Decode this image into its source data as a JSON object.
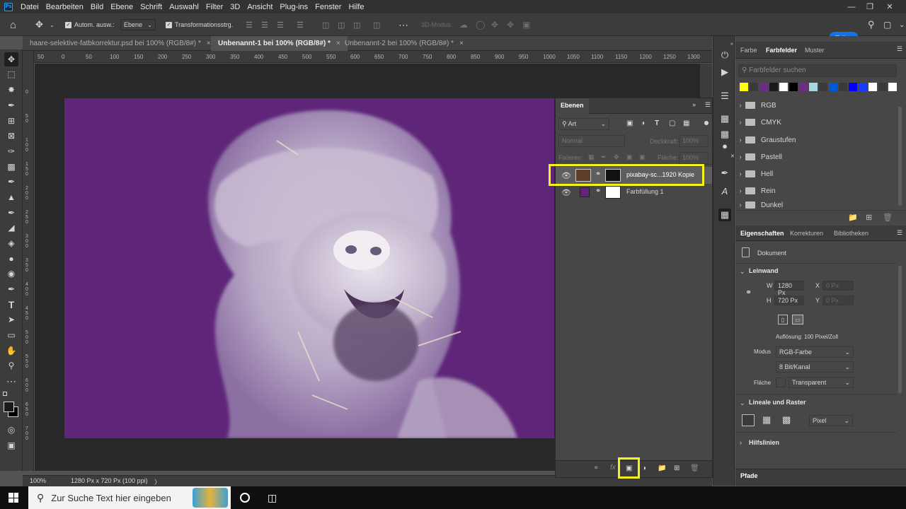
{
  "menubar": {
    "logo": "Ps",
    "items": [
      "Datei",
      "Bearbeiten",
      "Bild",
      "Ebene",
      "Schrift",
      "Auswahl",
      "Filter",
      "3D",
      "Ansicht",
      "Plug-ins",
      "Fenster",
      "Hilfe"
    ]
  },
  "options": {
    "auto_select_label": "Autom. ausw.:",
    "auto_select_value": "Ebene",
    "transform_label": "Transformationsstrg.",
    "mode3d_label": "3D-Modus:",
    "share_label": "Teilen"
  },
  "tabs": [
    {
      "label": "haare-selektive-fatbkorrektur.psd bei 100% (RGB/8#) *",
      "close": "×"
    },
    {
      "label": "Unbenannt-1 bei 100% (RGB/8#) *",
      "close": "×"
    },
    {
      "label": "Unbenannt-2 bei 100% (RGB/8#) *",
      "close": "×"
    }
  ],
  "ruler": {
    "h_ticks": [
      "50",
      "0",
      "50",
      "100",
      "150",
      "200",
      "250",
      "300",
      "350",
      "400",
      "450",
      "500",
      "550",
      "600",
      "650",
      "700",
      "750",
      "800",
      "850",
      "900",
      "950",
      "1000",
      "1050",
      "1100",
      "1150",
      "1200",
      "1250",
      "1300"
    ],
    "v_ticks": [
      "0",
      "5\n0",
      "1\n0\n0",
      "1\n5\n0",
      "2\n0\n0",
      "2\n5\n0",
      "3\n0\n0",
      "3\n5\n0",
      "4\n0\n0",
      "4\n5\n0",
      "5\n0\n0",
      "5\n5\n0",
      "6\n0\n0",
      "6\n5\n0",
      "7\n0\n0"
    ]
  },
  "status": {
    "zoom": "100%",
    "doc_info": "1280 Px x 720 Px (100 ppi)",
    "arrow": "〉"
  },
  "layers_panel": {
    "title": "Ebenen",
    "filter_kind": "Art",
    "blend_mode": "Normal",
    "opacity_label": "Deckkraft:",
    "opacity_value": "100%",
    "lock_label": "Fixieren:",
    "fill_label": "Fläche:",
    "fill_value": "100%",
    "layers": [
      {
        "name": "pixabay-sc...1920 Kopie",
        "selected": true
      },
      {
        "name": "Farbfüllung 1",
        "selected": false
      }
    ],
    "footer_icons": [
      "link-icon",
      "fx-icon",
      "mask-icon",
      "adjustment-icon",
      "folder-icon",
      "new-layer-icon",
      "trash-icon"
    ]
  },
  "swatches_panel": {
    "tabs": [
      "Farbe",
      "Farbfelder",
      "Muster"
    ],
    "active_tab": "Farbfelder",
    "search_placeholder": "Farbfelder suchen",
    "swatch_colors": [
      "#ffff00",
      "#3a3a3a",
      "#6b2d86",
      "#1a1a1a",
      "#ffffff",
      "#000000",
      "#6b2d86",
      "#a8d8e0",
      "#3a3a3a",
      "#0059d6",
      "#3a3a3a",
      "#0000ff",
      "#1a3aff",
      "#ffffff",
      "#3a3a3a",
      "#ffffff"
    ],
    "folders": [
      "RGB",
      "CMYK",
      "Graustufen",
      "Pastell",
      "Hell",
      "Rein",
      "Dunkel"
    ]
  },
  "properties_panel": {
    "tabs": [
      "Eigenschaften",
      "Korrekturen",
      "Bibliotheken"
    ],
    "active_tab": "Eigenschaften",
    "doc_label": "Dokument",
    "canvas_section": "Leinwand",
    "w_label": "W",
    "w_value": "1280 Px",
    "x_label": "X",
    "x_value": "0 Px",
    "h_label": "H",
    "h_value": "720 Px",
    "y_label": "Y",
    "y_value": "0 Px",
    "resolution": "Auflösung: 100 Pixel/Zoll",
    "mode_label": "Modus",
    "mode_value": "RGB-Farbe",
    "depth_value": "8 Bit/Kanal",
    "fill_label": "Fläche",
    "fill_value": "Transparent",
    "rulers_section": "Lineale und Raster",
    "unit_value": "Pixel",
    "guides_section": "Hilfslinien"
  },
  "paths_panel": {
    "title": "Pfade"
  },
  "taskbar": {
    "search_placeholder": "Zur Suche Text hier eingeben"
  },
  "highlight_color": "#f3f31c",
  "canvas_bg_color": "#5f2579"
}
